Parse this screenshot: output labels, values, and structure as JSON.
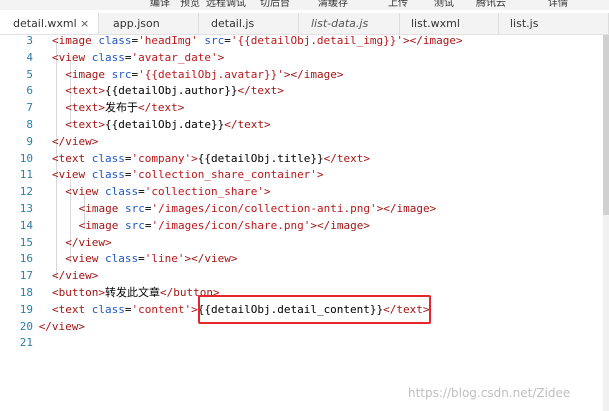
{
  "toolbar": {
    "items": [
      "编译",
      "预览",
      "远程调试",
      "切后台",
      "清缓存",
      "上传",
      "测试",
      "腾讯云",
      "详情"
    ]
  },
  "tabs": [
    {
      "label": "detail.wxml",
      "active": true,
      "closable": true,
      "close_glyph": "×"
    },
    {
      "label": "app.json"
    },
    {
      "label": "detail.js"
    },
    {
      "label": "list-data.js",
      "preview": true
    },
    {
      "label": "list.wxml"
    },
    {
      "label": "list.js"
    }
  ],
  "editor": {
    "lines": [
      {
        "n": "3",
        "tokens": [
          [
            "tag",
            "<image "
          ],
          [
            "attr",
            "class"
          ],
          [
            "br",
            "="
          ],
          [
            "str",
            "'headImg'"
          ],
          [
            "br",
            " "
          ],
          [
            "attr",
            "src"
          ],
          [
            "br",
            "="
          ],
          [
            "str",
            "'{{detailObj.detail_img}}'"
          ],
          [
            "tag",
            "></image>"
          ]
        ]
      },
      {
        "n": "4",
        "tokens": [
          [
            "tag",
            "<view "
          ],
          [
            "attr",
            "class"
          ],
          [
            "br",
            "="
          ],
          [
            "str",
            "'avatar_date'"
          ],
          [
            "tag",
            ">"
          ]
        ]
      },
      {
        "n": "5",
        "tokens": [
          [
            "tag",
            "<image "
          ],
          [
            "attr",
            "src"
          ],
          [
            "br",
            "="
          ],
          [
            "str",
            "'{{detailObj.avatar}}'"
          ],
          [
            "tag",
            "></image>"
          ]
        ]
      },
      {
        "n": "6",
        "tokens": [
          [
            "tag",
            "<text>"
          ],
          [
            "br",
            "{{detailObj.author}}"
          ],
          [
            "tag",
            "</text>"
          ]
        ]
      },
      {
        "n": "7",
        "tokens": [
          [
            "tag",
            "<text>"
          ],
          [
            "br",
            "发布于"
          ],
          [
            "tag",
            "</text>"
          ]
        ]
      },
      {
        "n": "8",
        "tokens": [
          [
            "tag",
            "<text>"
          ],
          [
            "br",
            "{{detailObj.date}}"
          ],
          [
            "tag",
            "</text>"
          ]
        ]
      },
      {
        "n": "9",
        "tokens": [
          [
            "tag",
            "</view>"
          ]
        ]
      },
      {
        "n": "10",
        "tokens": [
          [
            "tag",
            "<text "
          ],
          [
            "attr",
            "class"
          ],
          [
            "br",
            "="
          ],
          [
            "str",
            "'company'"
          ],
          [
            "tag",
            ">"
          ],
          [
            "br",
            "{{detailObj.title}}"
          ],
          [
            "tag",
            "</text>"
          ]
        ]
      },
      {
        "n": "11",
        "tokens": [
          [
            "tag",
            "<view "
          ],
          [
            "attr",
            "class"
          ],
          [
            "br",
            "="
          ],
          [
            "str",
            "'collection_share_container'"
          ],
          [
            "tag",
            ">"
          ]
        ]
      },
      {
        "n": "12",
        "tokens": [
          [
            "tag",
            "<view "
          ],
          [
            "attr",
            "class"
          ],
          [
            "br",
            "="
          ],
          [
            "str",
            "'collection_share'"
          ],
          [
            "tag",
            ">"
          ]
        ]
      },
      {
        "n": "13",
        "tokens": [
          [
            "tag",
            "<image "
          ],
          [
            "attr",
            "src"
          ],
          [
            "br",
            "="
          ],
          [
            "str",
            "'/images/icon/collection-anti.png'"
          ],
          [
            "tag",
            "></image>"
          ]
        ]
      },
      {
        "n": "14",
        "tokens": [
          [
            "tag",
            "<image "
          ],
          [
            "attr",
            "src"
          ],
          [
            "br",
            "="
          ],
          [
            "str",
            "'/images/icon/share.png'"
          ],
          [
            "tag",
            "></image>"
          ]
        ]
      },
      {
        "n": "15",
        "tokens": [
          [
            "tag",
            "</view>"
          ]
        ]
      },
      {
        "n": "16",
        "tokens": [
          [
            "tag",
            "<view "
          ],
          [
            "attr",
            "class"
          ],
          [
            "br",
            "="
          ],
          [
            "str",
            "'line'"
          ],
          [
            "tag",
            "></view>"
          ]
        ]
      },
      {
        "n": "17",
        "tokens": [
          [
            "tag",
            "</view>"
          ]
        ]
      },
      {
        "n": "18",
        "tokens": [
          [
            "tag",
            "<button>"
          ],
          [
            "br",
            "转发此文章"
          ],
          [
            "tag",
            "</button>"
          ]
        ]
      },
      {
        "n": "19",
        "tokens": [
          [
            "tag",
            "<text "
          ],
          [
            "attr",
            "class"
          ],
          [
            "br",
            "="
          ],
          [
            "str",
            "'content'"
          ],
          [
            "tag",
            ">"
          ],
          [
            "br",
            "{{detailObj.detail_content}}"
          ],
          [
            "tag",
            "</text>"
          ]
        ]
      },
      {
        "n": "20",
        "tokens": [
          [
            "tag",
            "</view>"
          ]
        ]
      },
      {
        "n": "21",
        "tokens": []
      }
    ]
  },
  "watermark": "https://blog.csdn.net/Zidee",
  "colors": {
    "tag": "#a31515",
    "attribute": "#1f57c4",
    "string": "#b8181b",
    "highlight_box": "#e8252b",
    "line_number": "#2b7fa8"
  }
}
